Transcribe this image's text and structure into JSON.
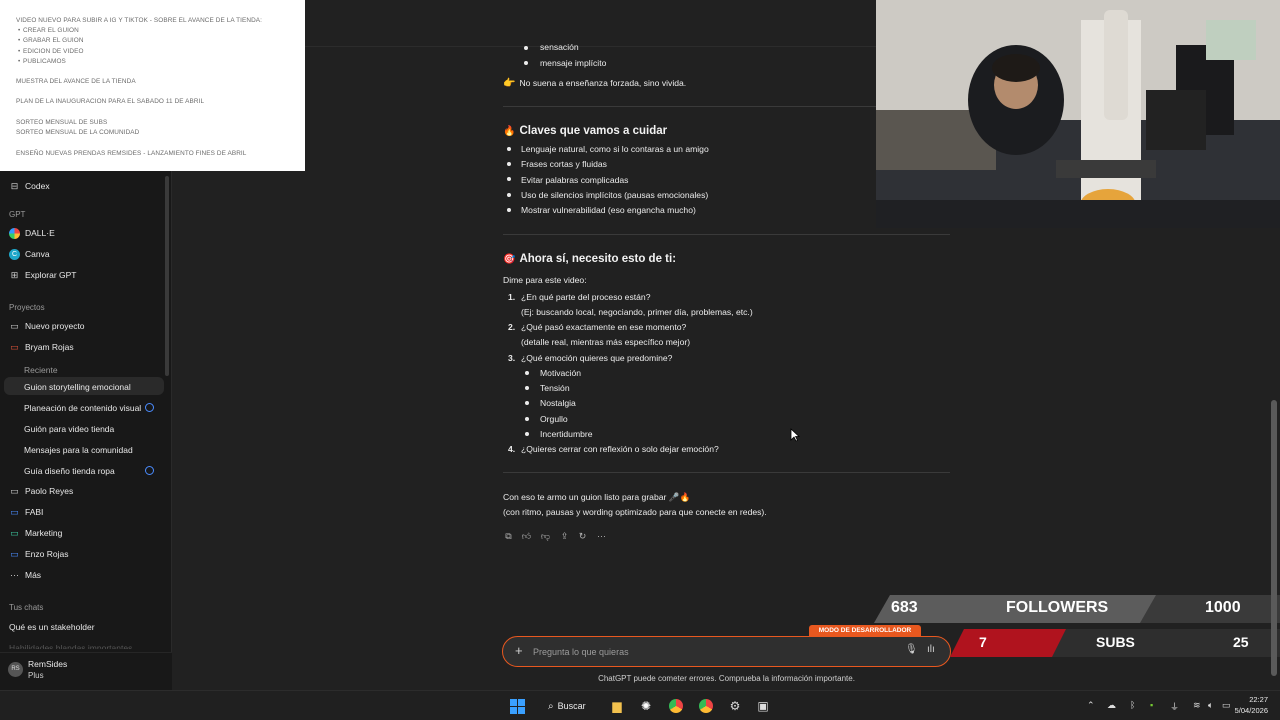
{
  "notes_overlay": {
    "lines": [
      "VIDEO NUEVO PARA SUBIR A IG Y TIKTOK - SOBRE EL AVANCE DE LA TIENDA:",
      "CREAR EL GUION",
      "GRABAR EL GUION",
      "EDICION DE VIDEO",
      "PUBLICAMOS",
      "MUESTRA DEL AVANCE DE LA TIENDA",
      "PLAN DE LA INAUGURACION PARA EL SABADO 11 DE ABRIL",
      "SORTEO MENSUAL DE SUBS",
      "SORTEO MENSUAL DE LA COMUNIDAD",
      "ENSEÑO NUEVAS PRENDAS REMSIDES - LANZAMIENTO FINES DE ABRIL"
    ]
  },
  "sidebar": {
    "codex": "Codex",
    "gpt_header": "GPT",
    "gpts": [
      "DALL·E",
      "Canva",
      "Explorar GPT"
    ],
    "projects_header": "Proyectos",
    "new_project": "Nuevo proyecto",
    "project_bryam": "Bryam Rojas",
    "recent_header": "Reciente",
    "recent_items": [
      "Guion storytelling emocional",
      "Planeación de contenido visual",
      "Guión para video tienda",
      "Mensajes para la comunidad",
      "Guía diseño tienda ropa"
    ],
    "other_projects": [
      "Paolo Reyes",
      "FABI",
      "Marketing",
      "Enzo Rojas"
    ],
    "more": "Más",
    "chats_header": "Tus chats",
    "chat_1": "Qué es un stakeholder",
    "chat_2_partial": "Habilidades blandas importantes",
    "user_name": "RemSides",
    "user_plan": "Plus"
  },
  "message": {
    "top_bullets": [
      "sensación",
      "mensaje implícito"
    ],
    "top_note": "No suena a enseñanza forzada, sino vivida.",
    "section1_title": "Claves que vamos a cuidar",
    "section1_bullets": [
      "Lenguaje natural, como si lo contaras a un amigo",
      "Frases cortas y fluidas",
      "Evitar palabras complicadas",
      "Uso de silencios implícitos (pausas emocionales)",
      "Mostrar vulnerabilidad (eso engancha mucho)"
    ],
    "section2_title": "Ahora sí, necesito esto de ti:",
    "intro": "Dime para este video:",
    "q1": "¿En qué parte del proceso están?",
    "q1_sub": "(Ej: buscando local, negociando, primer día, problemas, etc.)",
    "q2": "¿Qué pasó exactamente en ese momento?",
    "q2_sub": "(detalle real, mientras más específico mejor)",
    "q3": "¿Qué emoción quieres que predomine?",
    "emotions": [
      "Motivación",
      "Tensión",
      "Nostalgia",
      "Orgullo",
      "Incertidumbre"
    ],
    "q4": "¿Quieres cerrar con reflexión o solo dejar emoción?",
    "outro_1": "Con eso te armo un guion listo para grabar 🎤🔥",
    "outro_2": "(con ritmo, pausas y wording optimizado para que conecte en redes)."
  },
  "composer": {
    "placeholder": "Pregunta lo que quieras",
    "dev_mode": "MODO DE DESARROLLADOR",
    "disclaimer": "ChatGPT puede cometer errores. Comprueba la información importante."
  },
  "counters": {
    "followers_current": "683",
    "followers_label": "FOLLOWERS",
    "followers_goal": "1000",
    "subs_current": "7",
    "subs_label": "SUBS",
    "subs_goal": "25"
  },
  "taskbar": {
    "search": "Buscar",
    "time": "22:27",
    "date": "5/04/2026"
  }
}
